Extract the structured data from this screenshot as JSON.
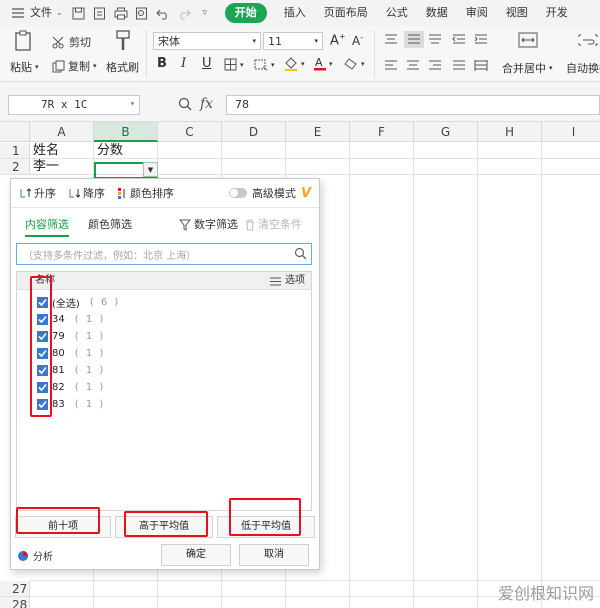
{
  "menubar": {
    "file_label": "文件",
    "tabs": [
      "开始",
      "插入",
      "页面布局",
      "公式",
      "数据",
      "审阅",
      "视图",
      "开发"
    ],
    "active_tab": "开始",
    "accent_color": "#1da557"
  },
  "ribbon": {
    "paste_label": "粘贴",
    "cut_label": "剪切",
    "copy_label": "复制",
    "format_painter_label": "格式刷",
    "font_name": "宋体",
    "font_size": "11",
    "merge_label": "合并居中",
    "autowrap_label": "自动换行"
  },
  "formula_bar": {
    "name_box": "7R x 1C",
    "fx_label": "fx",
    "value": "78"
  },
  "grid": {
    "columns": [
      "A",
      "B",
      "C",
      "D",
      "E",
      "F",
      "G",
      "H",
      "I"
    ],
    "selected_column": "B",
    "rows_top": [
      "1",
      "2"
    ],
    "rows_bottom": [
      "27",
      "28"
    ],
    "cells": {
      "A1": "姓名",
      "B1": "分数",
      "A2": "李一"
    }
  },
  "filter": {
    "sort_asc": "升序",
    "sort_desc": "降序",
    "sort_color": "颜色排序",
    "advanced_mode": "高级模式",
    "advanced_badge": "V",
    "tab_content": "内容筛选",
    "tab_color": "颜色筛选",
    "number_filter": "数字筛选",
    "clear_condition": "清空条件",
    "search_placeholder": "（支持多条件过滤，例如：北京 上海）",
    "list_header": "名称",
    "options_label": "选项",
    "items": [
      {
        "label": "(全选)",
        "count": "( 6 )"
      },
      {
        "label": "34",
        "count": "( 1 )"
      },
      {
        "label": "79",
        "count": "( 1 )"
      },
      {
        "label": "80",
        "count": "( 1 )"
      },
      {
        "label": "81",
        "count": "( 1 )"
      },
      {
        "label": "82",
        "count": "( 1 )"
      },
      {
        "label": "83",
        "count": "( 1 )"
      }
    ],
    "top10": "前十项",
    "above_avg": "高于平均值",
    "below_avg": "低于平均值",
    "analysis": "分析",
    "ok": "确定",
    "cancel": "取消"
  },
  "watermark": "爱创根知识网",
  "colors": {
    "selection_green": "#1a9e4b",
    "checkbox_blue": "#3c78c8",
    "annotation_red": "#e8101a"
  }
}
